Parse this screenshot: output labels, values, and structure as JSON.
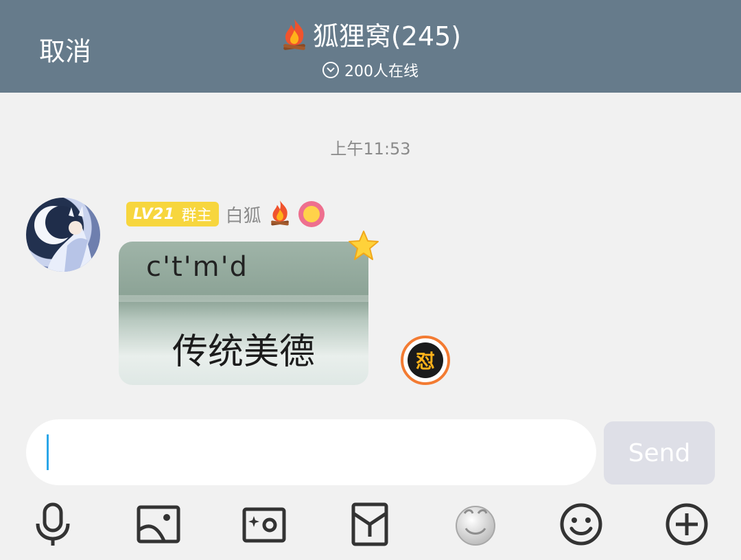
{
  "header": {
    "cancel_label": "取消",
    "title": "狐狸窝(245)",
    "online": "200人在线"
  },
  "chat": {
    "timestamp": "上午11:53",
    "message": {
      "level_badge": "LV21",
      "role": "群主",
      "nickname": "白狐",
      "sticker_top_text": "c't'm'd",
      "sticker_text": "传统美德",
      "reaction_text": "怼"
    }
  },
  "input": {
    "value": "",
    "send_label": "Send"
  },
  "toolbar": {
    "icons": [
      "microphone-icon",
      "image-icon",
      "camera-icon",
      "red-envelope-icon",
      "sticker-face-icon",
      "smiley-icon",
      "plus-icon"
    ]
  },
  "colors": {
    "header_bg": "#667b8b",
    "badge_bg": "#f7d63e",
    "caret": "#2aa6e8",
    "send_bg": "#dedfe7"
  }
}
